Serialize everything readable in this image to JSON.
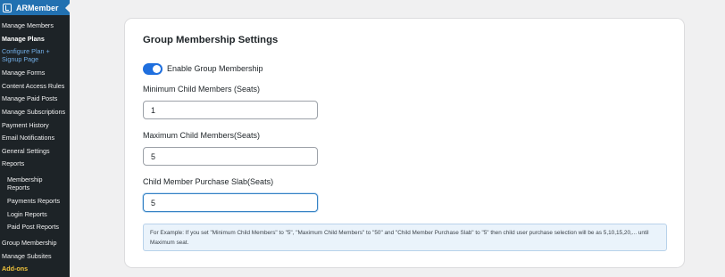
{
  "sidebar": {
    "title": "ARMember",
    "items": [
      {
        "label": "Manage Members"
      },
      {
        "label": "Manage Plans"
      },
      {
        "label": "Configure Plan +"
      },
      {
        "label": "Signup Page"
      },
      {
        "label": "Manage Forms"
      },
      {
        "label": "Content Access Rules"
      },
      {
        "label": "Manage Paid Posts"
      },
      {
        "label": "Manage Subscriptions"
      },
      {
        "label": "Payment History"
      },
      {
        "label": "Email Notifications"
      },
      {
        "label": "General Settings"
      },
      {
        "label": "Reports"
      },
      {
        "label": "Membership"
      },
      {
        "label": "Reports"
      },
      {
        "label": "Payments Reports"
      },
      {
        "label": "Login Reports"
      },
      {
        "label": "Paid Post Reports"
      },
      {
        "label": "Group Membership"
      },
      {
        "label": "Manage Subsites"
      },
      {
        "label": "Add-ons"
      }
    ]
  },
  "card": {
    "title": "Group Membership Settings",
    "toggle_label": "Enable Group Membership",
    "toggle_on": true,
    "min_label": "Minimum Child Members (Seats)",
    "min_value": "1",
    "max_label": "Maximum Child Members(Seats)",
    "max_value": "5",
    "slab_label": "Child Member Purchase Slab(Seats)",
    "slab_value": "5",
    "note": "For Example: If you set \"Minimum Child Members\" to \"5\", \"Maximum Child Members\" to \"50\" and \"Child Member Purchase Slab\" to \"5\" then child user purchase selection will be as 5,10,15,20,... until Maximum seat."
  },
  "colors": {
    "sidebar_bg": "#1d2327",
    "sidebar_header": "#2271b1",
    "toggle_on": "#1f6fde",
    "addons": "#f0c33c"
  }
}
